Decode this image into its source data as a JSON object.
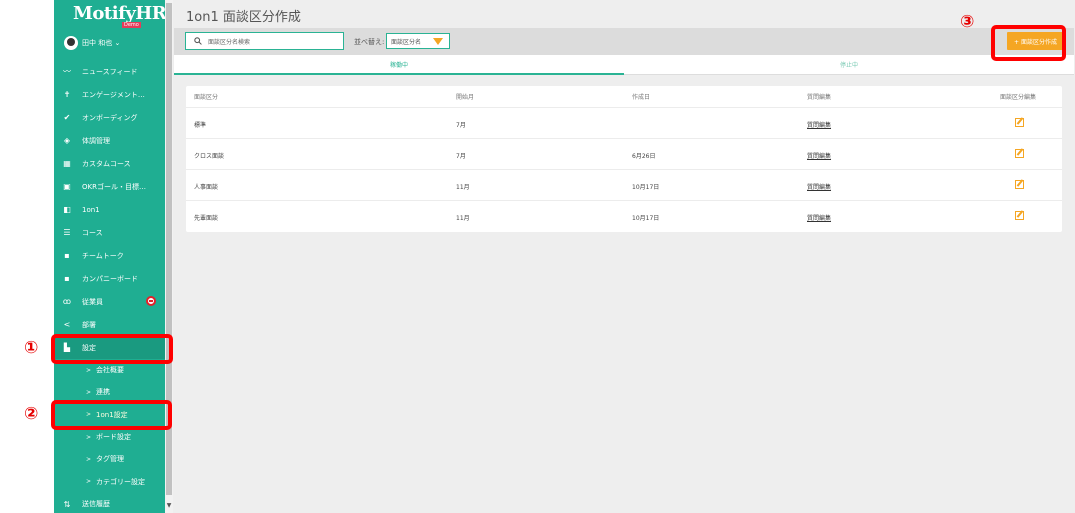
{
  "app": {
    "logo": "MotifyHR",
    "logo_badge": "Demo"
  },
  "user": {
    "name": "田中 和也 ⌄"
  },
  "nav": {
    "items": [
      {
        "label": "ニュースフィード",
        "icon": "trend-icon",
        "glyph": "〰"
      },
      {
        "label": "エンゲージメント…",
        "icon": "person-icon",
        "glyph": "✝"
      },
      {
        "label": "オンボーディング",
        "icon": "check-circle-icon",
        "glyph": "✔"
      },
      {
        "label": "体調管理",
        "icon": "tag-icon",
        "glyph": "◈"
      },
      {
        "label": "カスタムコース",
        "icon": "grid-icon",
        "glyph": "▦"
      },
      {
        "label": "OKRゴール・目標…",
        "icon": "copy-icon",
        "glyph": "▣"
      },
      {
        "label": "1on1",
        "icon": "map-icon",
        "glyph": "◧"
      },
      {
        "label": "コース",
        "icon": "list-icon",
        "glyph": "☰"
      },
      {
        "label": "チームトーク",
        "icon": "chat-icon",
        "glyph": "▪"
      },
      {
        "label": "カンパニーボード",
        "icon": "forum-icon",
        "glyph": "▪"
      },
      {
        "label": "従業員",
        "icon": "people-icon",
        "glyph": "ꝏ"
      },
      {
        "label": "部署",
        "icon": "share-icon",
        "glyph": "<"
      },
      {
        "label": "設定",
        "icon": "settings-bars-icon",
        "glyph": "▙"
      }
    ],
    "sub_items": [
      {
        "label": "会社概要"
      },
      {
        "label": "連携"
      },
      {
        "label": "1on1設定"
      },
      {
        "label": "ボード設定"
      },
      {
        "label": "タグ管理"
      },
      {
        "label": "カテゴリー設定"
      }
    ],
    "last": {
      "label": "送信履歴",
      "icon": "sort-icon",
      "glyph": "⇅"
    }
  },
  "page": {
    "title": "1on1 面談区分作成"
  },
  "toolbar": {
    "search_placeholder": "面談区分名検索",
    "sort_label": "並べ替え:",
    "sort_value": "面談区分名",
    "create_label": "+ 面談区分作成"
  },
  "tabs": [
    {
      "label": "稼働中"
    },
    {
      "label": "停止中"
    }
  ],
  "table": {
    "headers": [
      "面談区分",
      "開始月",
      "作成日",
      "質問編集",
      "面談区分編集"
    ],
    "rows": [
      {
        "name": "標準",
        "month": "7月",
        "created": "",
        "question": "質問編集"
      },
      {
        "name": "クロス面談",
        "month": "7月",
        "created": "6月26日",
        "question": "質問編集"
      },
      {
        "name": "人事面談",
        "month": "11月",
        "created": "10月17日",
        "question": "質問編集"
      },
      {
        "name": "先輩面談",
        "month": "11月",
        "created": "10月17日",
        "question": "質問編集"
      }
    ]
  },
  "annotations": {
    "one": "①",
    "two": "②",
    "three": "③"
  },
  "colors": {
    "sidebar": "#1fae92",
    "accent": "#2ab394",
    "button": "#f5a623",
    "annotation": "#ff0000"
  }
}
